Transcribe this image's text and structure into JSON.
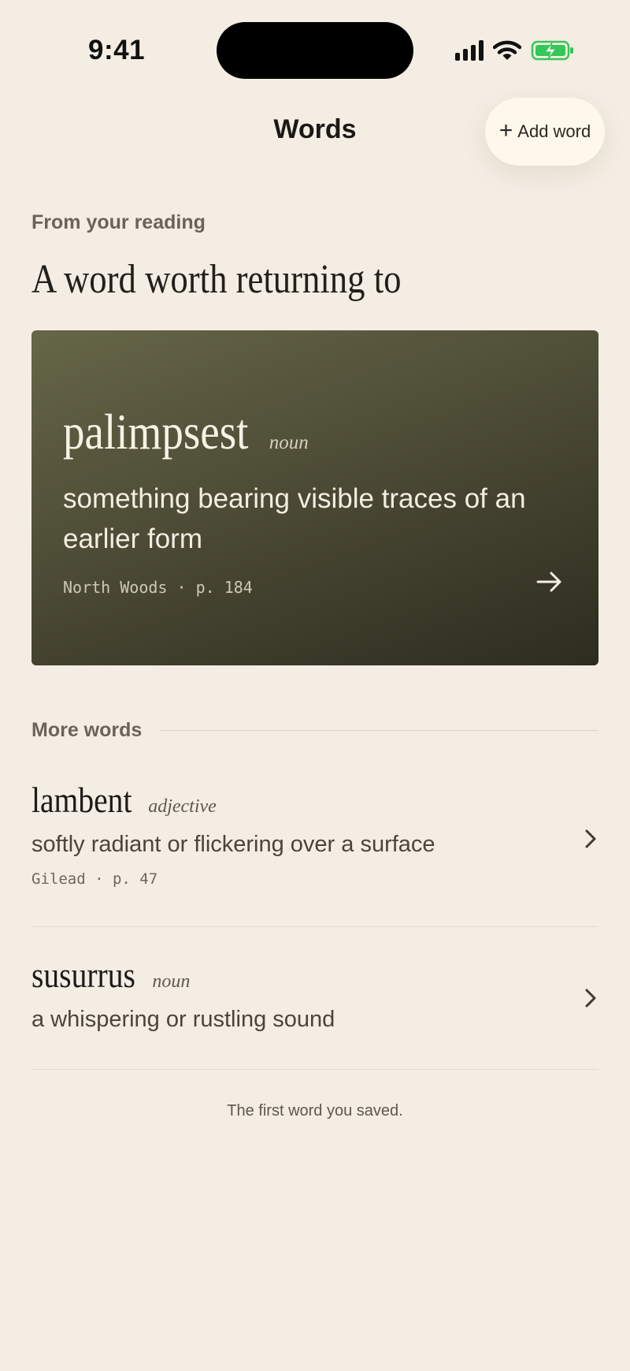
{
  "status_bar": {
    "time": "9:41"
  },
  "header": {
    "title": "Words",
    "add_button_label": "Add word"
  },
  "featured": {
    "eyebrow": "From your reading",
    "heading": "A word worth returning to",
    "word": "palimpsest",
    "part_of_speech": "noun",
    "definition": "something bearing visible traces of an earlier form",
    "source": "North Woods · p. 184"
  },
  "more": {
    "label": "More words",
    "items": [
      {
        "word": "lambent",
        "part_of_speech": "adjective",
        "definition": "softly radiant or flickering over a surface",
        "source": "Gilead · p. 47"
      },
      {
        "word": "susurrus",
        "part_of_speech": "noun",
        "definition": "a whispering or rustling sound"
      }
    ]
  },
  "footer_note": "The first word you saved.",
  "colors": {
    "background": "#f4ede3",
    "card_gradient_start": "#666648",
    "card_gradient_end": "#2e2c1f",
    "button_background": "#fdf8ea",
    "battery_green": "#34c759"
  }
}
